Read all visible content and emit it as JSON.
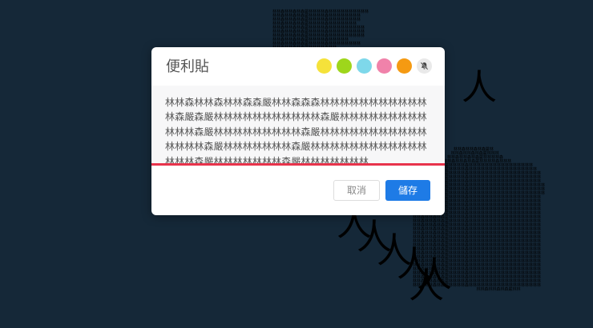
{
  "background": {
    "accent_color": "#152838",
    "large_glyph": "人",
    "tiny_pattern": "林林森林林森林森嚴林林林森林林林林林林"
  },
  "dialog": {
    "title": "便利貼",
    "color_swatches": [
      {
        "name": "yellow",
        "color": "#f5e23a"
      },
      {
        "name": "green",
        "color": "#9ed61b"
      },
      {
        "name": "cyan",
        "color": "#7ed8ea"
      },
      {
        "name": "pink",
        "color": "#f082aa"
      },
      {
        "name": "orange",
        "color": "#f59a12"
      }
    ],
    "mute_icon": "bell-slash-icon",
    "note_text": "林林森林林森林林森森嚴林林森森森林林林林林林林林林林林林森嚴森嚴林林林林林林林林林林林森嚴林林林林林林林林林林林林森嚴林林林林林林林林林森嚴林林林林林林林林林林林林林林林森嚴林林林林林林林森嚴林林林林林林林林林林林林林林林森嚴林林林林林林林森嚴林林林林林林林",
    "cancel_label": "取消",
    "save_label": "儲存"
  }
}
